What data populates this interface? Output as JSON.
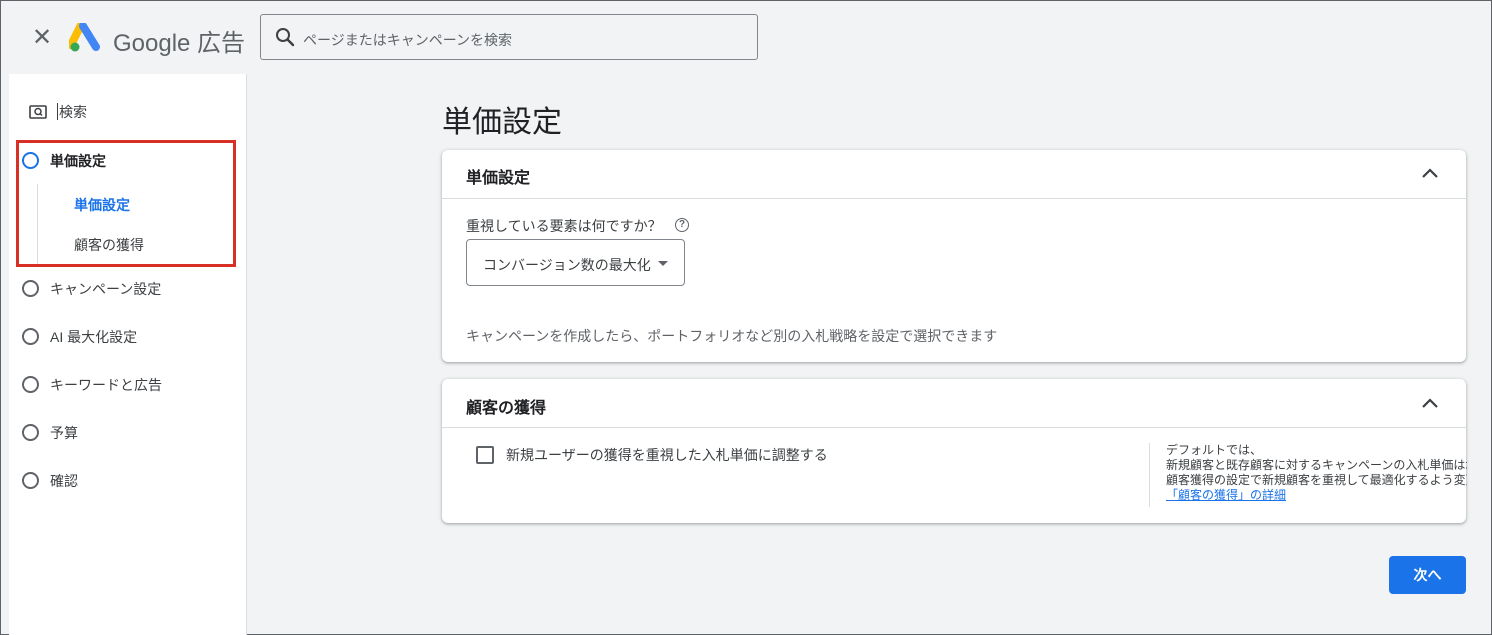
{
  "header": {
    "close_glyph": "✕",
    "brand": "Google 広告",
    "search_placeholder": "ページまたはキャンペーンを検索"
  },
  "sidebar": {
    "search_label": "検索",
    "steps": [
      {
        "label": "単価設定",
        "active": true
      },
      {
        "label": "キャンペーン設定"
      },
      {
        "label": "AI 最大化設定"
      },
      {
        "label": "キーワードと広告"
      },
      {
        "label": "予算"
      },
      {
        "label": "確認"
      }
    ],
    "substeps": [
      {
        "label": "単価設定",
        "active": true
      },
      {
        "label": "顧客の獲得"
      }
    ]
  },
  "main": {
    "page_title": "単価設定",
    "bidding_card": {
      "title": "単価設定",
      "question": "重視している要素は何ですか？",
      "help_glyph": "?",
      "dropdown_value": "コンバージョン数の最大化",
      "note": "キャンペーンを作成したら、ポートフォリオなど別の入札戦略を設定で選択できます"
    },
    "acquisition_card": {
      "title": "顧客の獲得",
      "checkbox_label": "新規ユーザーの獲得を重視した入札単価に調整する",
      "checked": false,
      "side_lines": [
        "デフォルトでは、",
        "新規顧客と既存顧客に対するキャンペーンの入札単価は均等",
        "顧客獲得の設定で新規顧客を重視して最適化するよう変更す"
      ],
      "side_link": "「顧客の獲得」の詳細"
    },
    "next_button": "次へ"
  },
  "colors": {
    "accent": "#1a73e8",
    "highlight_border": "#d93025",
    "background": "#f1f3f4"
  }
}
